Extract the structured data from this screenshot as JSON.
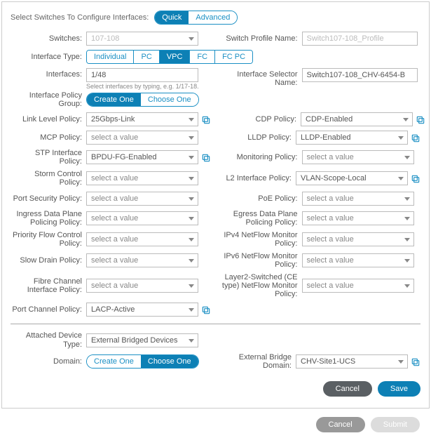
{
  "header": {
    "prompt": "Select Switches To Configure Interfaces:",
    "mode_quick": "Quick",
    "mode_advanced": "Advanced"
  },
  "labels": {
    "switches": "Switches:",
    "switch_profile_name": "Switch Profile Name:",
    "interface_type": "Interface Type:",
    "interfaces": "Interfaces:",
    "interface_selector_name": "Interface Selector Name:",
    "ipg": "Interface Policy Group:",
    "link_level": "Link Level Policy:",
    "cdp": "CDP Policy:",
    "mcp": "MCP Policy:",
    "lldp": "LLDP Policy:",
    "stp": "STP Interface Policy:",
    "monitoring": "Monitoring Policy:",
    "storm": "Storm Control Policy:",
    "l2iface": "L2 Interface Policy:",
    "portsec": "Port Security Policy:",
    "poe": "PoE Policy:",
    "ingressdp": "Ingress Data Plane Policing Policy:",
    "egressdp": "Egress Data Plane Policing Policy:",
    "pfc": "Priority Flow Control Policy:",
    "ipv4nf": "IPv4 NetFlow Monitor Policy:",
    "slowdrain": "Slow Drain Policy:",
    "ipv6nf": "IPv6 NetFlow Monitor Policy:",
    "fci": "Fibre Channel Interface Policy:",
    "l2nf": "Layer2-Switched (CE type) NetFlow Monitor Policy:",
    "portchannel": "Port Channel Policy:",
    "attached_device": "Attached Device Type:",
    "domain": "Domain:",
    "ext_bridge_domain": "External Bridge Domain:"
  },
  "values": {
    "switches": "107-108",
    "switch_profile_name_ph": "Switch107-108_Profile",
    "interfaces": "1/48",
    "interfaces_hint": "Select interfaces by typing, e.g. 1/17-18.",
    "interface_selector_name": "Switch107-108_CHV-6454-B",
    "link_level": "25Gbps-Link",
    "cdp": "CDP-Enabled",
    "mcp": "select a value",
    "lldp": "LLDP-Enabled",
    "stp": "BPDU-FG-Enabled",
    "monitoring": "select a value",
    "storm": "select a value",
    "l2iface": "VLAN-Scope-Local",
    "portsec": "select a value",
    "poe": "select a value",
    "ingressdp": "select a value",
    "egressdp": "select a value",
    "pfc": "select a value",
    "ipv4nf": "select a value",
    "slowdrain": "select a value",
    "ipv6nf": "select a value",
    "fci": "select a value",
    "l2nf": "select a value",
    "portchannel": "LACP-Active",
    "attached_device": "External Bridged Devices",
    "ext_bridge_domain": "CHV-Site1-UCS"
  },
  "iface_type": {
    "individual": "Individual",
    "pc": "PC",
    "vpc": "VPC",
    "fc": "FC",
    "fcpc": "FC PC"
  },
  "pg_actions": {
    "create": "Create One",
    "choose": "Choose One"
  },
  "domain_actions": {
    "create": "Create One",
    "choose": "Choose One"
  },
  "buttons": {
    "cancel": "Cancel",
    "save": "Save",
    "submit": "Submit"
  }
}
